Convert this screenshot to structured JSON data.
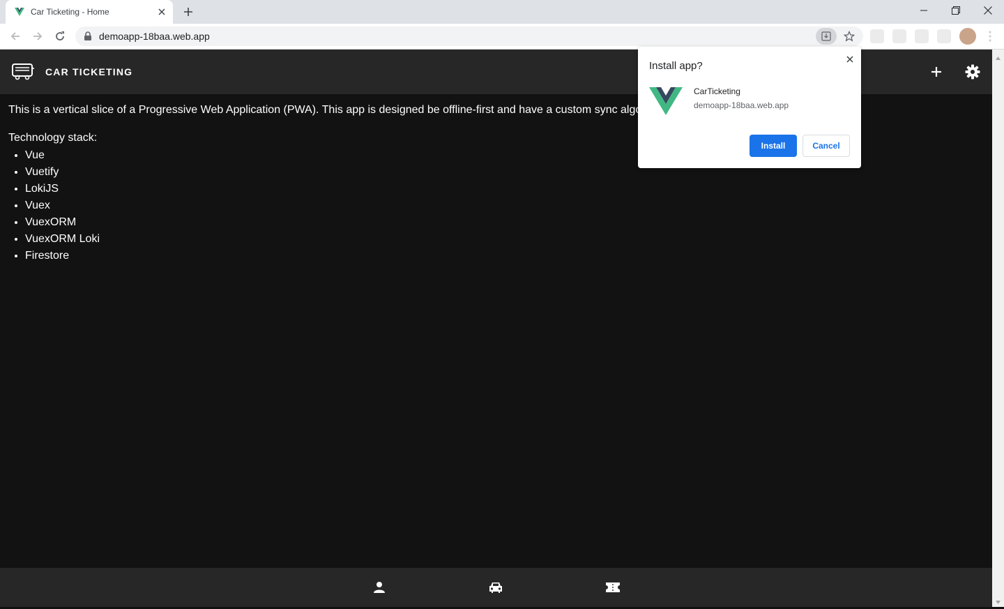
{
  "browser": {
    "tab": {
      "title": "Car Ticketing - Home",
      "favicon": "vue-logo-icon"
    },
    "address_bar": {
      "url": "demoapp-18baa.web.app"
    }
  },
  "app": {
    "title": "CAR TICKETING",
    "intro": "This is a vertical slice of a Progressive Web Application (PWA). This app is designed be offline-first and have a custom sync algorithm",
    "stack_label": "Technology stack:",
    "stack": [
      "Vue",
      "Vuetify",
      "LokiJS",
      "Vuex",
      "VuexORM",
      "VuexORM Loki",
      "Firestore"
    ],
    "bottom_nav": [
      "person-icon",
      "car-icon",
      "ticket-icon"
    ]
  },
  "install_popup": {
    "title": "Install app?",
    "app_name": "CarTicketing",
    "origin": "demoapp-18baa.web.app",
    "install_label": "Install",
    "cancel_label": "Cancel"
  },
  "colors": {
    "page_bg": "#121212",
    "appbar_bg": "#272727",
    "accent_blue": "#1a73e8",
    "vue_green": "#41b883",
    "vue_dark": "#35495e"
  }
}
